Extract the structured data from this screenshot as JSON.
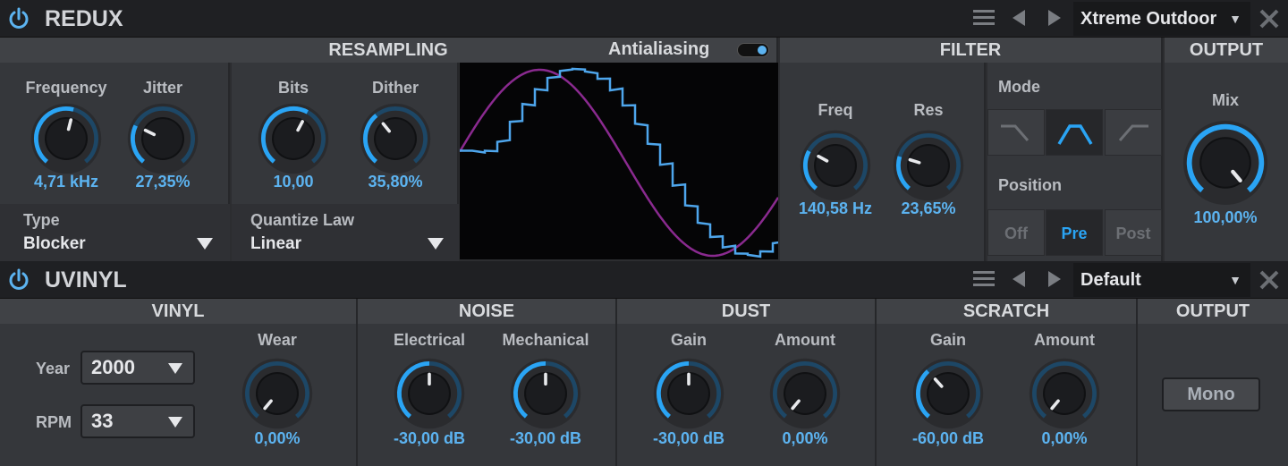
{
  "redux": {
    "title": "REDUX",
    "preset": "Xtreme Outdoor",
    "sections": {
      "resampling": "RESAMPLING",
      "antialiasing": "Antialiasing",
      "filter": "FILTER",
      "output": "OUTPUT"
    },
    "antialiasing_on": true,
    "knobs": {
      "frequency": {
        "label": "Frequency",
        "value": "4,71 kHz",
        "level": 0.55
      },
      "jitter": {
        "label": "Jitter",
        "value": "27,35%",
        "level": 0.27
      },
      "bits": {
        "label": "Bits",
        "value": "10,00",
        "level": 0.6
      },
      "dither": {
        "label": "Dither",
        "value": "35,80%",
        "level": 0.36
      },
      "freq": {
        "label": "Freq",
        "value": "140,58 Hz",
        "level": 0.28
      },
      "res": {
        "label": "Res",
        "value": "23,65%",
        "level": 0.24
      },
      "mix": {
        "label": "Mix",
        "value": "100,00%",
        "level": 1.0
      }
    },
    "type": {
      "label": "Type",
      "value": "Blocker"
    },
    "quantize": {
      "label": "Quantize Law",
      "value": "Linear"
    },
    "mode_label": "Mode",
    "mode_selected": "bandpass",
    "position": {
      "label": "Position",
      "options": [
        "Off",
        "Pre",
        "Post"
      ],
      "selected": "Pre"
    }
  },
  "uvinyl": {
    "title": "UVINYL",
    "preset": "Default",
    "sections": {
      "vinyl": "VINYL",
      "noise": "NOISE",
      "dust": "DUST",
      "scratch": "SCRATCH",
      "output": "OUTPUT"
    },
    "year": {
      "label": "Year",
      "value": "2000"
    },
    "rpm": {
      "label": "RPM",
      "value": "33"
    },
    "knobs": {
      "wear": {
        "label": "Wear",
        "value": "0,00%",
        "level": 0.0
      },
      "electrical": {
        "label": "Electrical",
        "value": "-30,00 dB",
        "level": 0.5
      },
      "mechanical": {
        "label": "Mechanical",
        "value": "-30,00 dB",
        "level": 0.5
      },
      "dust_gain": {
        "label": "Gain",
        "value": "-30,00 dB",
        "level": 0.5
      },
      "dust_amount": {
        "label": "Amount",
        "value": "0,00%",
        "level": 0.0
      },
      "scratch_gain": {
        "label": "Gain",
        "value": "-60,00 dB",
        "level": 0.35
      },
      "scratch_amount": {
        "label": "Amount",
        "value": "0,00%",
        "level": 0.0
      }
    },
    "mono_label": "Mono"
  },
  "colors": {
    "accent": "#2aa4f4",
    "value_text": "#5cb3f0",
    "scope_blue": "#4ea6ec",
    "scope_purple": "#8a2a8f"
  },
  "icons": [
    "power-icon",
    "hamburger-menu-icon",
    "prev-arrow-icon",
    "next-arrow-icon",
    "close-icon",
    "dropdown-caret-icon",
    "lowpass-icon",
    "bandpass-icon",
    "highpass-icon"
  ]
}
